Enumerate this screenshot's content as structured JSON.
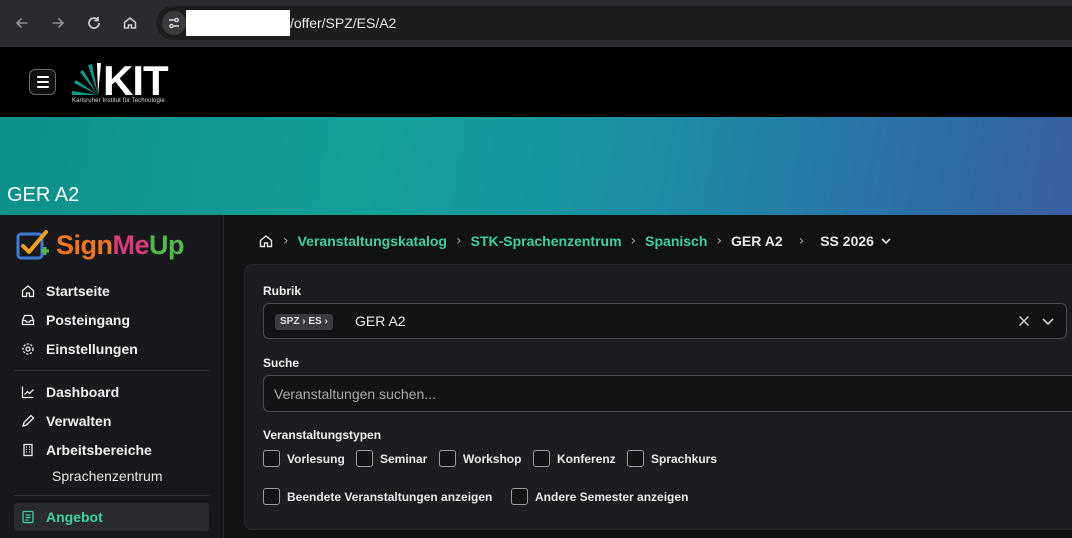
{
  "browser": {
    "url_suffix": "/offer/SPZ/ES/A2"
  },
  "header": {
    "logo_text": "KIT",
    "logo_subtitle": "Karlsruher Institut für Technologie"
  },
  "banner": {
    "title": "GER A2"
  },
  "sidebar": {
    "brand": {
      "sign": "Sign",
      "me": "Me",
      "up": "Up"
    },
    "items": [
      {
        "label": "Startseite",
        "icon": "home-icon"
      },
      {
        "label": "Posteingang",
        "icon": "inbox-icon"
      },
      {
        "label": "Einstellungen",
        "icon": "gear-icon"
      },
      {
        "label": "Dashboard",
        "icon": "chart-icon"
      },
      {
        "label": "Verwalten",
        "icon": "pencil-icon"
      },
      {
        "label": "Arbeitsbereiche",
        "icon": "building-icon"
      },
      {
        "label": "Angebot",
        "icon": "list-icon"
      }
    ],
    "sub_items": [
      "Sprachenzentrum"
    ],
    "accent": "#3fd1a0"
  },
  "breadcrumb": {
    "items": [
      "Veranstaltungskatalog",
      "STK-Sprachenzentrum",
      "Spanisch",
      "GER A2"
    ],
    "semester": "SS 2026"
  },
  "filters": {
    "rubrik_label": "Rubrik",
    "rubrik_chip": "SPZ › ES ›",
    "rubrik_value": "GER A2",
    "search_label": "Suche",
    "search_placeholder": "Veranstaltungen suchen...",
    "types_label": "Veranstaltungstypen",
    "types": [
      "Vorlesung",
      "Seminar",
      "Workshop",
      "Konferenz",
      "Sprachkurs"
    ],
    "options": [
      "Beendete Veranstaltungen anzeigen",
      "Andere Semester anzeigen"
    ]
  }
}
